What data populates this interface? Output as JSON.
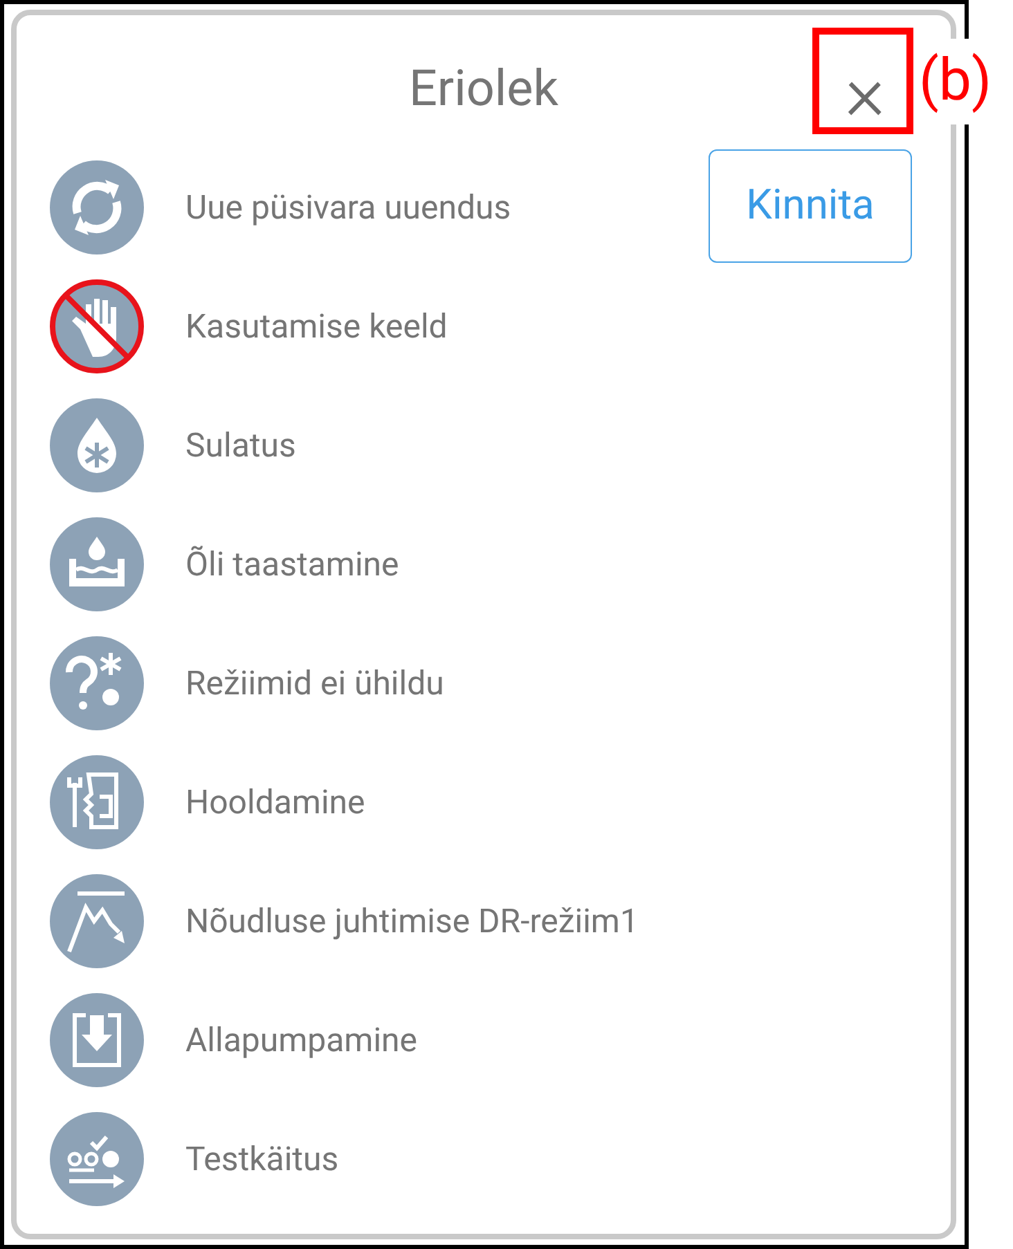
{
  "dialog": {
    "title": "Eriolek",
    "close": "×"
  },
  "items": [
    {
      "kind": "refresh",
      "label": "Uue püsivara uuendus",
      "action": "Kinnita"
    },
    {
      "kind": "prohibited",
      "label": "Kasutamise keeld"
    },
    {
      "kind": "defrost",
      "label": "Sulatus"
    },
    {
      "kind": "oil",
      "label": "Õli taastamine"
    },
    {
      "kind": "conflict",
      "label": "Režiimid ei ühildu"
    },
    {
      "kind": "maintenance",
      "label": "Hooldamine"
    },
    {
      "kind": "demand",
      "label": "Nõudluse juhtimise DR-režiim1"
    },
    {
      "kind": "pumpdown",
      "label": "Allapumpamine"
    },
    {
      "kind": "test",
      "label": "Testkäitus"
    }
  ],
  "annotation": {
    "label": "(b)"
  }
}
